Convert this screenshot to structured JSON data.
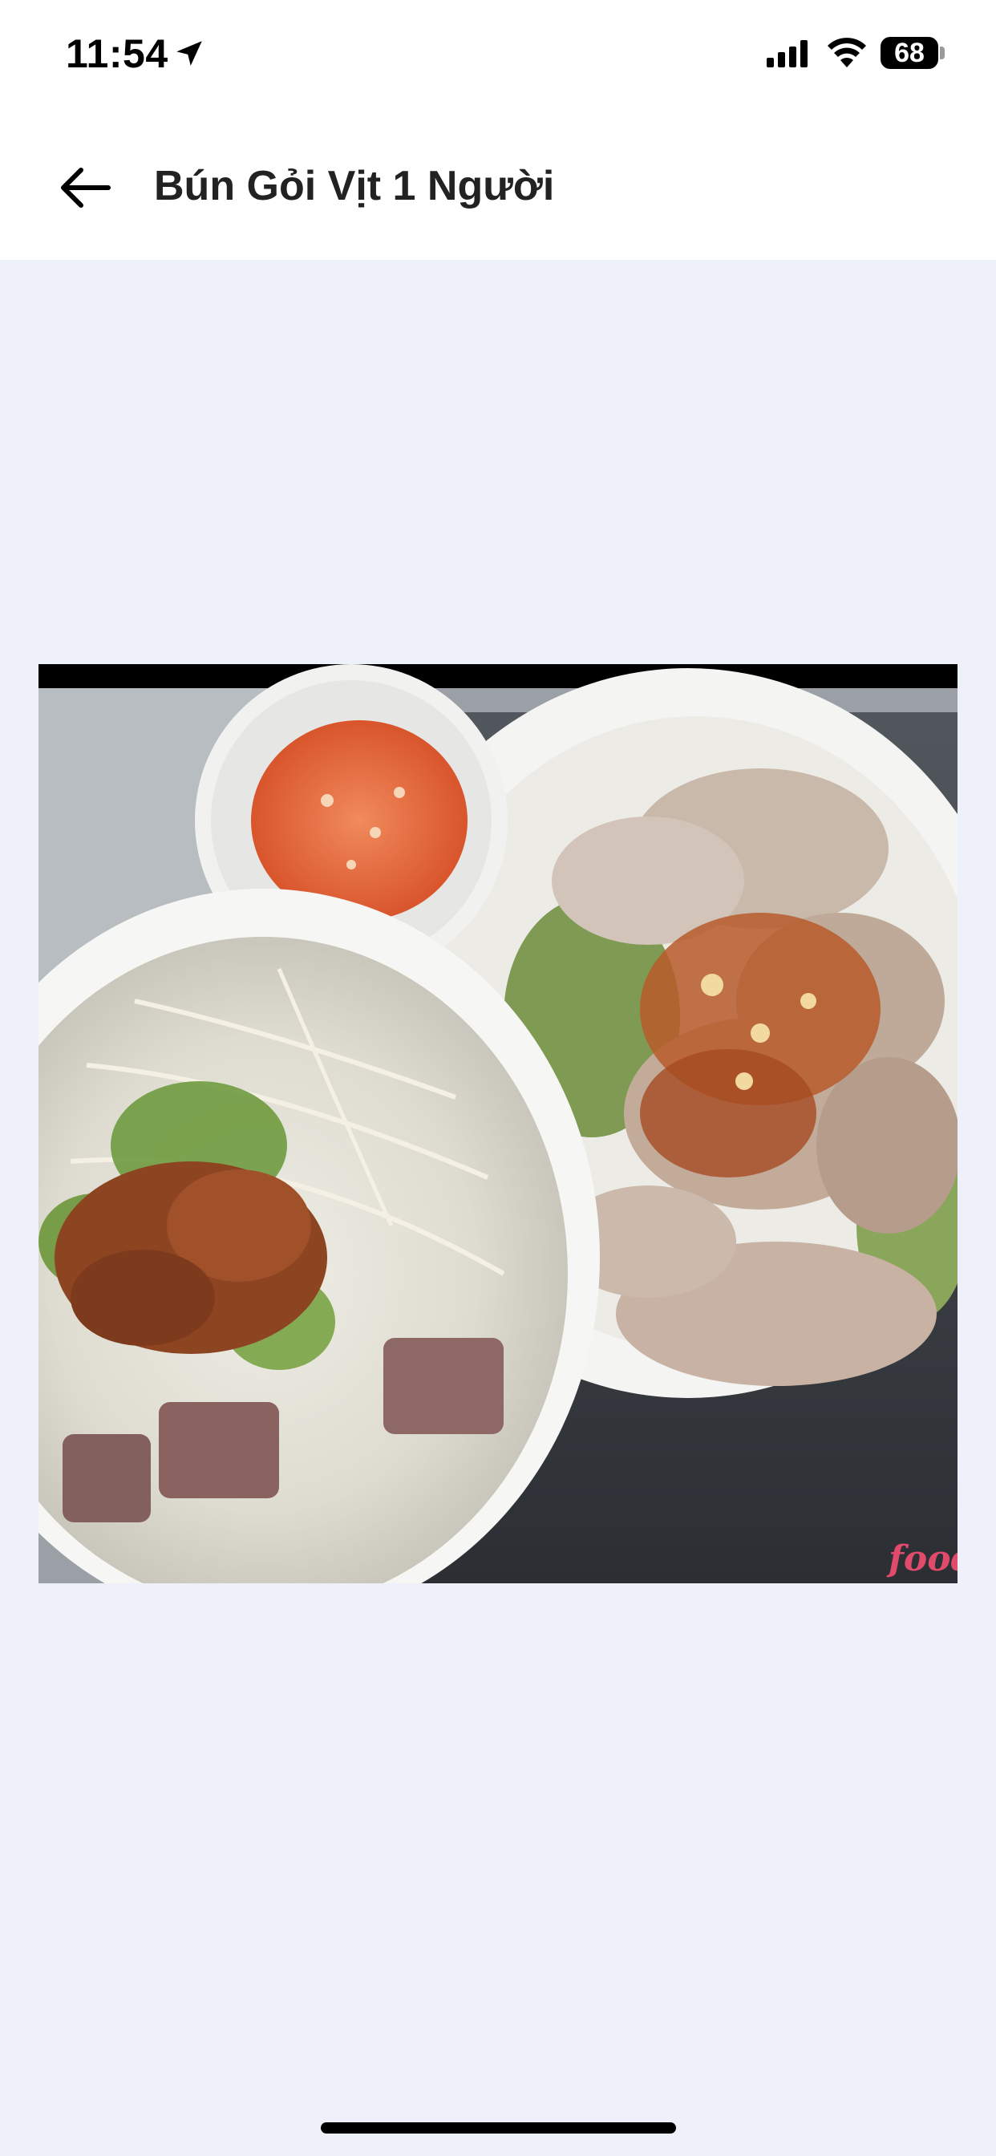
{
  "status_bar": {
    "time": "11:54",
    "battery": "68",
    "icons": [
      "location-arrow-icon",
      "cellular-signal-icon",
      "wifi-icon",
      "battery-icon"
    ]
  },
  "header": {
    "title": "Bún Gỏi Vịt 1 Người",
    "back_icon": "arrow-left-icon"
  },
  "photo": {
    "watermark": "foody"
  },
  "colors": {
    "background": "#eef1fa",
    "header_bg": "#ffffff",
    "title": "#222222"
  }
}
